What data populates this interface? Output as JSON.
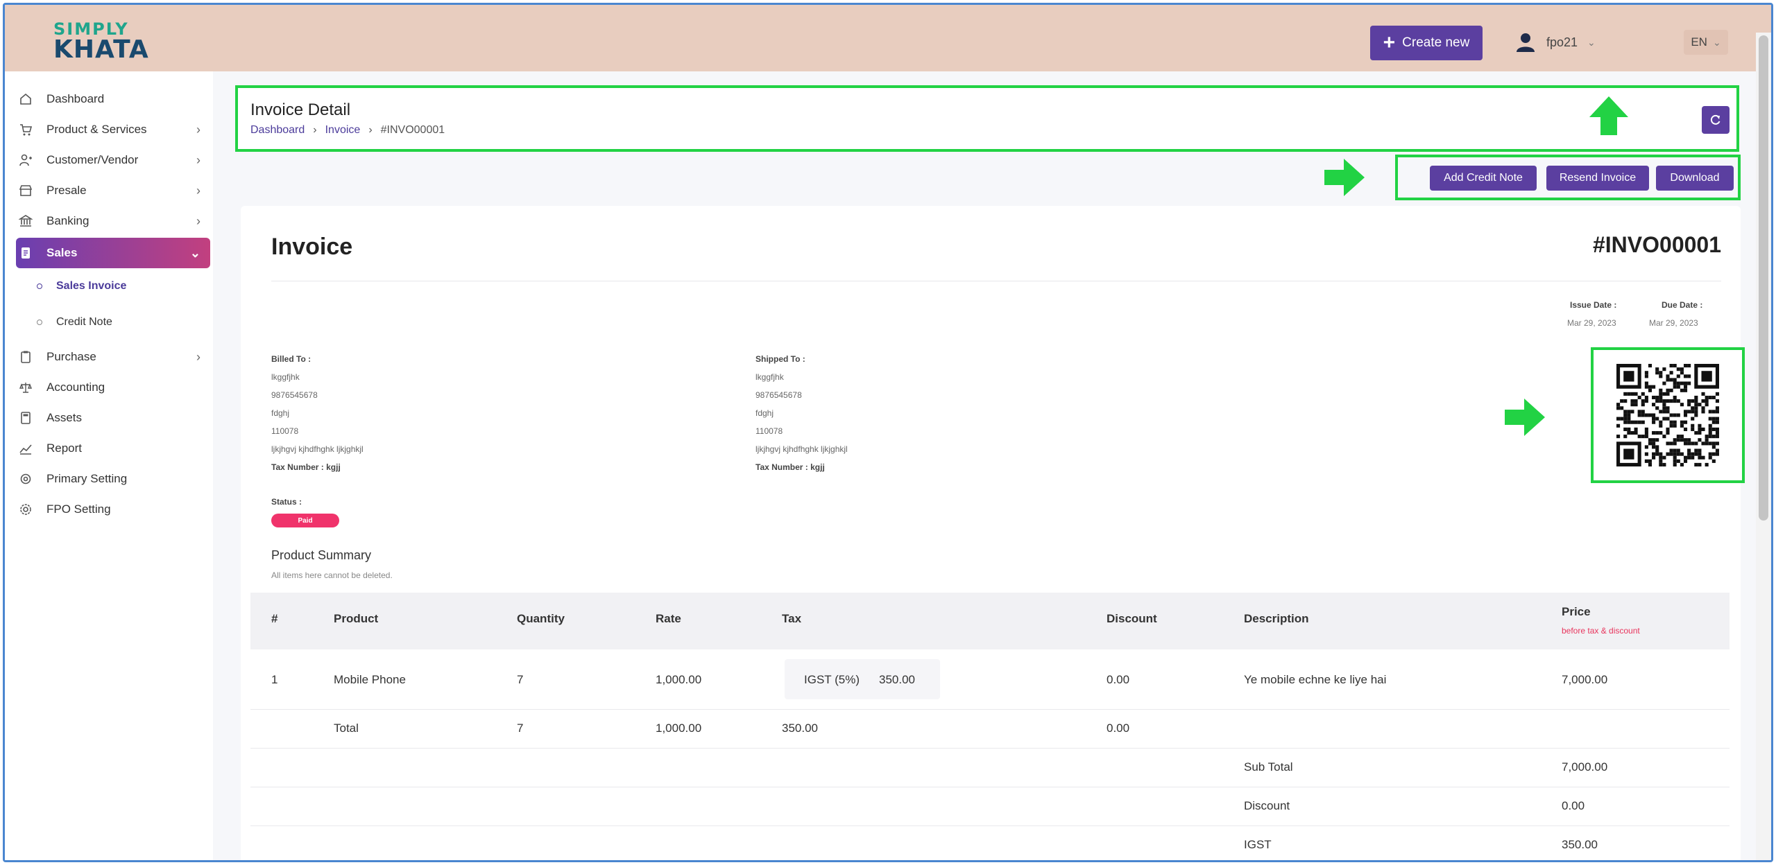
{
  "header": {
    "logo_line1": "SIMPLY",
    "logo_line2": "KHATA",
    "create_label": "Create new",
    "user_name": "fpo21",
    "language": "EN"
  },
  "sidebar": {
    "items": [
      {
        "label": "Dashboard",
        "icon": "home-icon"
      },
      {
        "label": "Product & Services",
        "icon": "cart-icon",
        "has_children": true
      },
      {
        "label": "Customer/Vendor",
        "icon": "user-plus-icon",
        "has_children": true
      },
      {
        "label": "Presale",
        "icon": "store-icon",
        "has_children": true
      },
      {
        "label": "Banking",
        "icon": "bank-icon",
        "has_children": true
      },
      {
        "label": "Sales",
        "icon": "document-icon",
        "has_children": true,
        "active": true
      },
      {
        "label": "Purchase",
        "icon": "clipboard-icon",
        "has_children": true
      },
      {
        "label": "Accounting",
        "icon": "scale-icon"
      },
      {
        "label": "Assets",
        "icon": "calculator-icon"
      },
      {
        "label": "Report",
        "icon": "chart-icon"
      },
      {
        "label": "Primary Setting",
        "icon": "settings-icon"
      },
      {
        "label": "FPO Setting",
        "icon": "gear-icon"
      }
    ],
    "sales_sub": [
      {
        "label": "Sales Invoice",
        "current": true
      },
      {
        "label": "Credit Note"
      }
    ]
  },
  "page": {
    "title": "Invoice Detail",
    "breadcrumb": [
      "Dashboard",
      "Invoice",
      "#INVO00001"
    ],
    "actions": {
      "add_credit": "Add Credit Note",
      "resend": "Resend Invoice",
      "download": "Download"
    }
  },
  "invoice": {
    "title": "Invoice",
    "number": "#INVO00001",
    "issue_label": "Issue Date :",
    "issue_date": "Mar 29, 2023",
    "due_label": "Due Date :",
    "due_date": "Mar 29, 2023",
    "billed": {
      "heading": "Billed To :",
      "name": "lkggfjhk",
      "phone": "9876545678",
      "city": "fdghj",
      "pin": "110078",
      "address": "ljkjhgvj kjhdfhghk ljkjghkjl",
      "tax": "Tax Number : kgjj"
    },
    "shipped": {
      "heading": "Shipped To :",
      "name": "lkggfjhk",
      "phone": "9876545678",
      "city": "fdghj",
      "pin": "110078",
      "address": "ljkjhgvj kjhdfhghk ljkjghkjl",
      "tax": "Tax Number : kgjj"
    },
    "status_label": "Status :",
    "status": "Paid",
    "summary_title": "Product Summary",
    "summary_note": "All items here cannot be deleted.",
    "columns": {
      "num": "#",
      "product": "Product",
      "quantity": "Quantity",
      "rate": "Rate",
      "tax": "Tax",
      "discount": "Discount",
      "description": "Description",
      "price": "Price",
      "price_sub": "before tax & discount"
    },
    "rows": [
      {
        "num": "1",
        "product": "Mobile Phone",
        "quantity": "7",
        "rate": "1,000.00",
        "tax_name": "IGST (5%)",
        "tax_amount": "350.00",
        "discount": "0.00",
        "description": "Ye mobile echne ke liye hai",
        "price": "7,000.00"
      }
    ],
    "total": {
      "label": "Total",
      "quantity": "7",
      "rate": "1,000.00",
      "tax": "350.00",
      "discount": "0.00"
    },
    "summary": [
      {
        "label": "Sub Total",
        "value": "7,000.00"
      },
      {
        "label": "Discount",
        "value": "0.00"
      },
      {
        "label": "IGST",
        "value": "350.00"
      }
    ]
  },
  "colors": {
    "header_bg": "#e8cdbf",
    "primary": "#5b3fa0",
    "highlight": "#22d244",
    "status_paid": "#f0336b"
  }
}
